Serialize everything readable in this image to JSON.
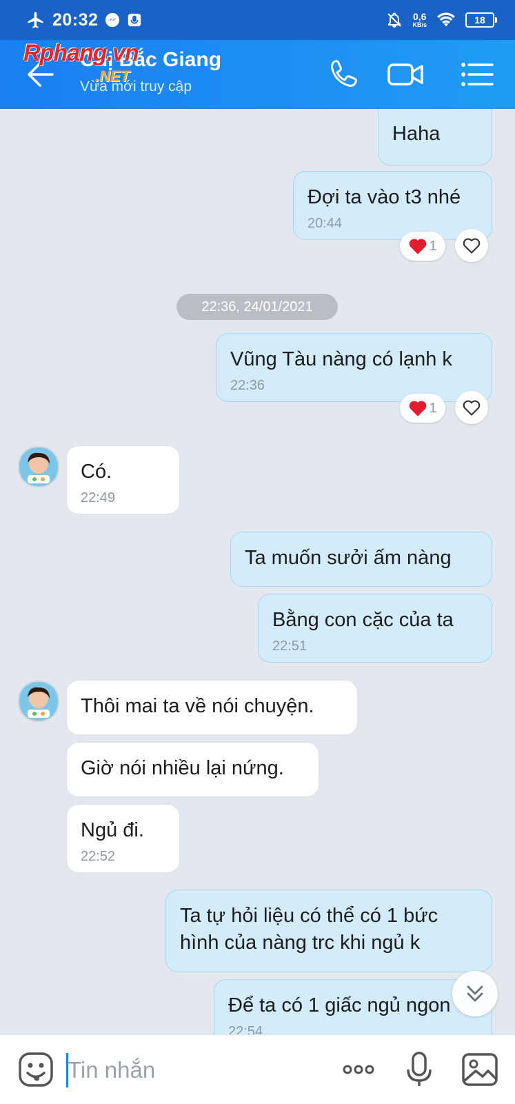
{
  "status_bar": {
    "time": "20:32",
    "speed_value": "0,6",
    "speed_unit": "KB/s",
    "battery": "18"
  },
  "header": {
    "contact_name": "Chị Bắc Giang",
    "status": "Vừa mới truy cập",
    "watermark_main": "Rphang.vn",
    "watermark_sub": ".NET"
  },
  "chat": {
    "date_separator": "22:36, 24/01/2021",
    "messages": [
      {
        "text": "Haha"
      },
      {
        "text": "Đợi ta vào t3 nhé",
        "time": "20:44",
        "reaction_count": "1"
      },
      {
        "text": "Vũng Tàu nàng có lạnh k",
        "time": "22:36",
        "reaction_count": "1"
      },
      {
        "text": "Có.",
        "time": "22:49"
      },
      {
        "text": "Ta muốn sưởi ấm nàng"
      },
      {
        "text": "Bằng con cặc của ta",
        "time": "22:51"
      },
      {
        "text": "Thôi mai ta về nói chuyện."
      },
      {
        "text": "Giờ nói nhiều lại nứng."
      },
      {
        "text": "Ngủ đi.",
        "time": "22:52"
      },
      {
        "text_line1": "Ta tự hỏi liệu có thể có 1 bức",
        "text_line2": "hình của nàng trc khi ngủ k"
      },
      {
        "text": "Để ta có 1 giấc ngủ ngon",
        "time": "22:54"
      }
    ]
  },
  "input_bar": {
    "placeholder": "Tin nhắn",
    "value": ""
  },
  "colors": {
    "header": "#1b7ff2",
    "status_bar": "#1a62c6",
    "my_bubble": "#d3ecfc",
    "their_bubble": "#ffffff",
    "chat_background": "#e3e8ee",
    "heart": "#e11d2e"
  },
  "icons": {
    "back": "arrow-left-icon",
    "call": "phone-icon",
    "video": "video-camera-icon",
    "menu": "list-menu-icon",
    "sticker": "sticker-face-icon",
    "more": "more-dots-icon",
    "mic": "microphone-icon",
    "image": "image-icon",
    "scroll": "double-chevron-down-icon"
  }
}
